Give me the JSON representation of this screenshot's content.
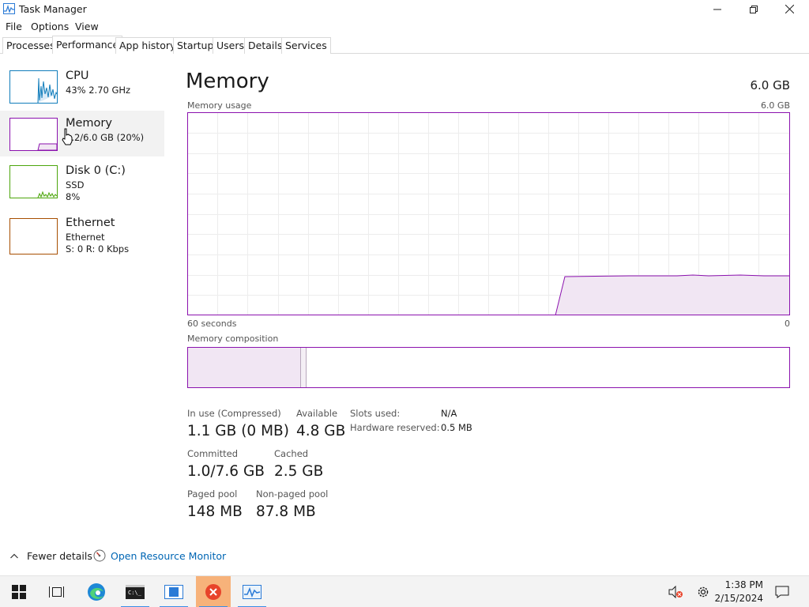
{
  "window": {
    "title": "Task Manager"
  },
  "menu": [
    "File",
    "Options",
    "View"
  ],
  "tabs": [
    "Processes",
    "Performance",
    "App history",
    "Startup",
    "Users",
    "Details",
    "Services"
  ],
  "sidebar": {
    "items": [
      {
        "title": "CPU",
        "line1": "43%  2.70 GHz",
        "line2": "",
        "color": "#117dbb"
      },
      {
        "title": "Memory",
        "line1": "1.2/6.0 GB (20%)",
        "line2": "",
        "color": "#8b12ae"
      },
      {
        "title": "Disk 0 (C:)",
        "line1": "SSD",
        "line2": "8%",
        "color": "#4da60c"
      },
      {
        "title": "Ethernet",
        "line1": "Ethernet",
        "line2": "S: 0  R: 0 Kbps",
        "color": "#a74f01"
      }
    ]
  },
  "main": {
    "title": "Memory",
    "total": "6.0 GB",
    "usage_label": "Memory usage",
    "usage_max": "6.0 GB",
    "time_left": "60 seconds",
    "time_right": "0",
    "composition_label": "Memory composition",
    "accent": "#8b12ae"
  },
  "stats": {
    "in_use_label": "In use (Compressed)",
    "in_use_value": "1.1 GB (0 MB)",
    "available_label": "Available",
    "available_value": "4.8 GB",
    "committed_label": "Committed",
    "committed_value": "1.0/7.6 GB",
    "cached_label": "Cached",
    "cached_value": "2.5 GB",
    "paged_label": "Paged pool",
    "paged_value": "148 MB",
    "nonpaged_label": "Non-paged pool",
    "nonpaged_value": "87.8 MB",
    "slots_label": "Slots used:",
    "slots_value": "N/A",
    "hw_reserved_label": "Hardware reserved:",
    "hw_reserved_value": "0.5 MB"
  },
  "footer": {
    "fewer_details": "Fewer details",
    "open_resource_monitor": "Open Resource Monitor"
  },
  "taskbar": {
    "time": "1:38 PM",
    "date": "2/15/2024",
    "icons": [
      "windows-start-icon",
      "task-view-icon",
      "edge-browser-icon",
      "terminal-icon",
      "file-explorer-icon",
      "close-app-icon",
      "task-manager-icon",
      "speaker-muted-icon",
      "settings-gear-icon",
      "notification-icon"
    ]
  }
}
